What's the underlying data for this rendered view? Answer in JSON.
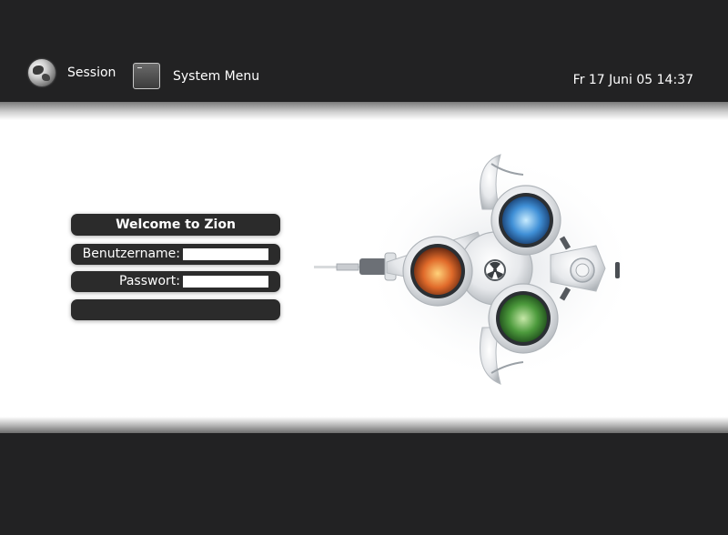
{
  "top_bar": {
    "session": {
      "label": "Session",
      "icon": "globe-icon"
    },
    "system_menu": {
      "label": "System Menu",
      "icon": "terminal-icon"
    },
    "clock": "Fr 17 Juni 05 14:37"
  },
  "login": {
    "title": "Welcome to Zion",
    "username_label": "Benutzername:",
    "username_value": "",
    "password_label": "Passwort:",
    "password_value": ""
  },
  "colors": {
    "bar": "#222223",
    "panel": "#2b2b2b",
    "content_bg": "#ffffff"
  }
}
